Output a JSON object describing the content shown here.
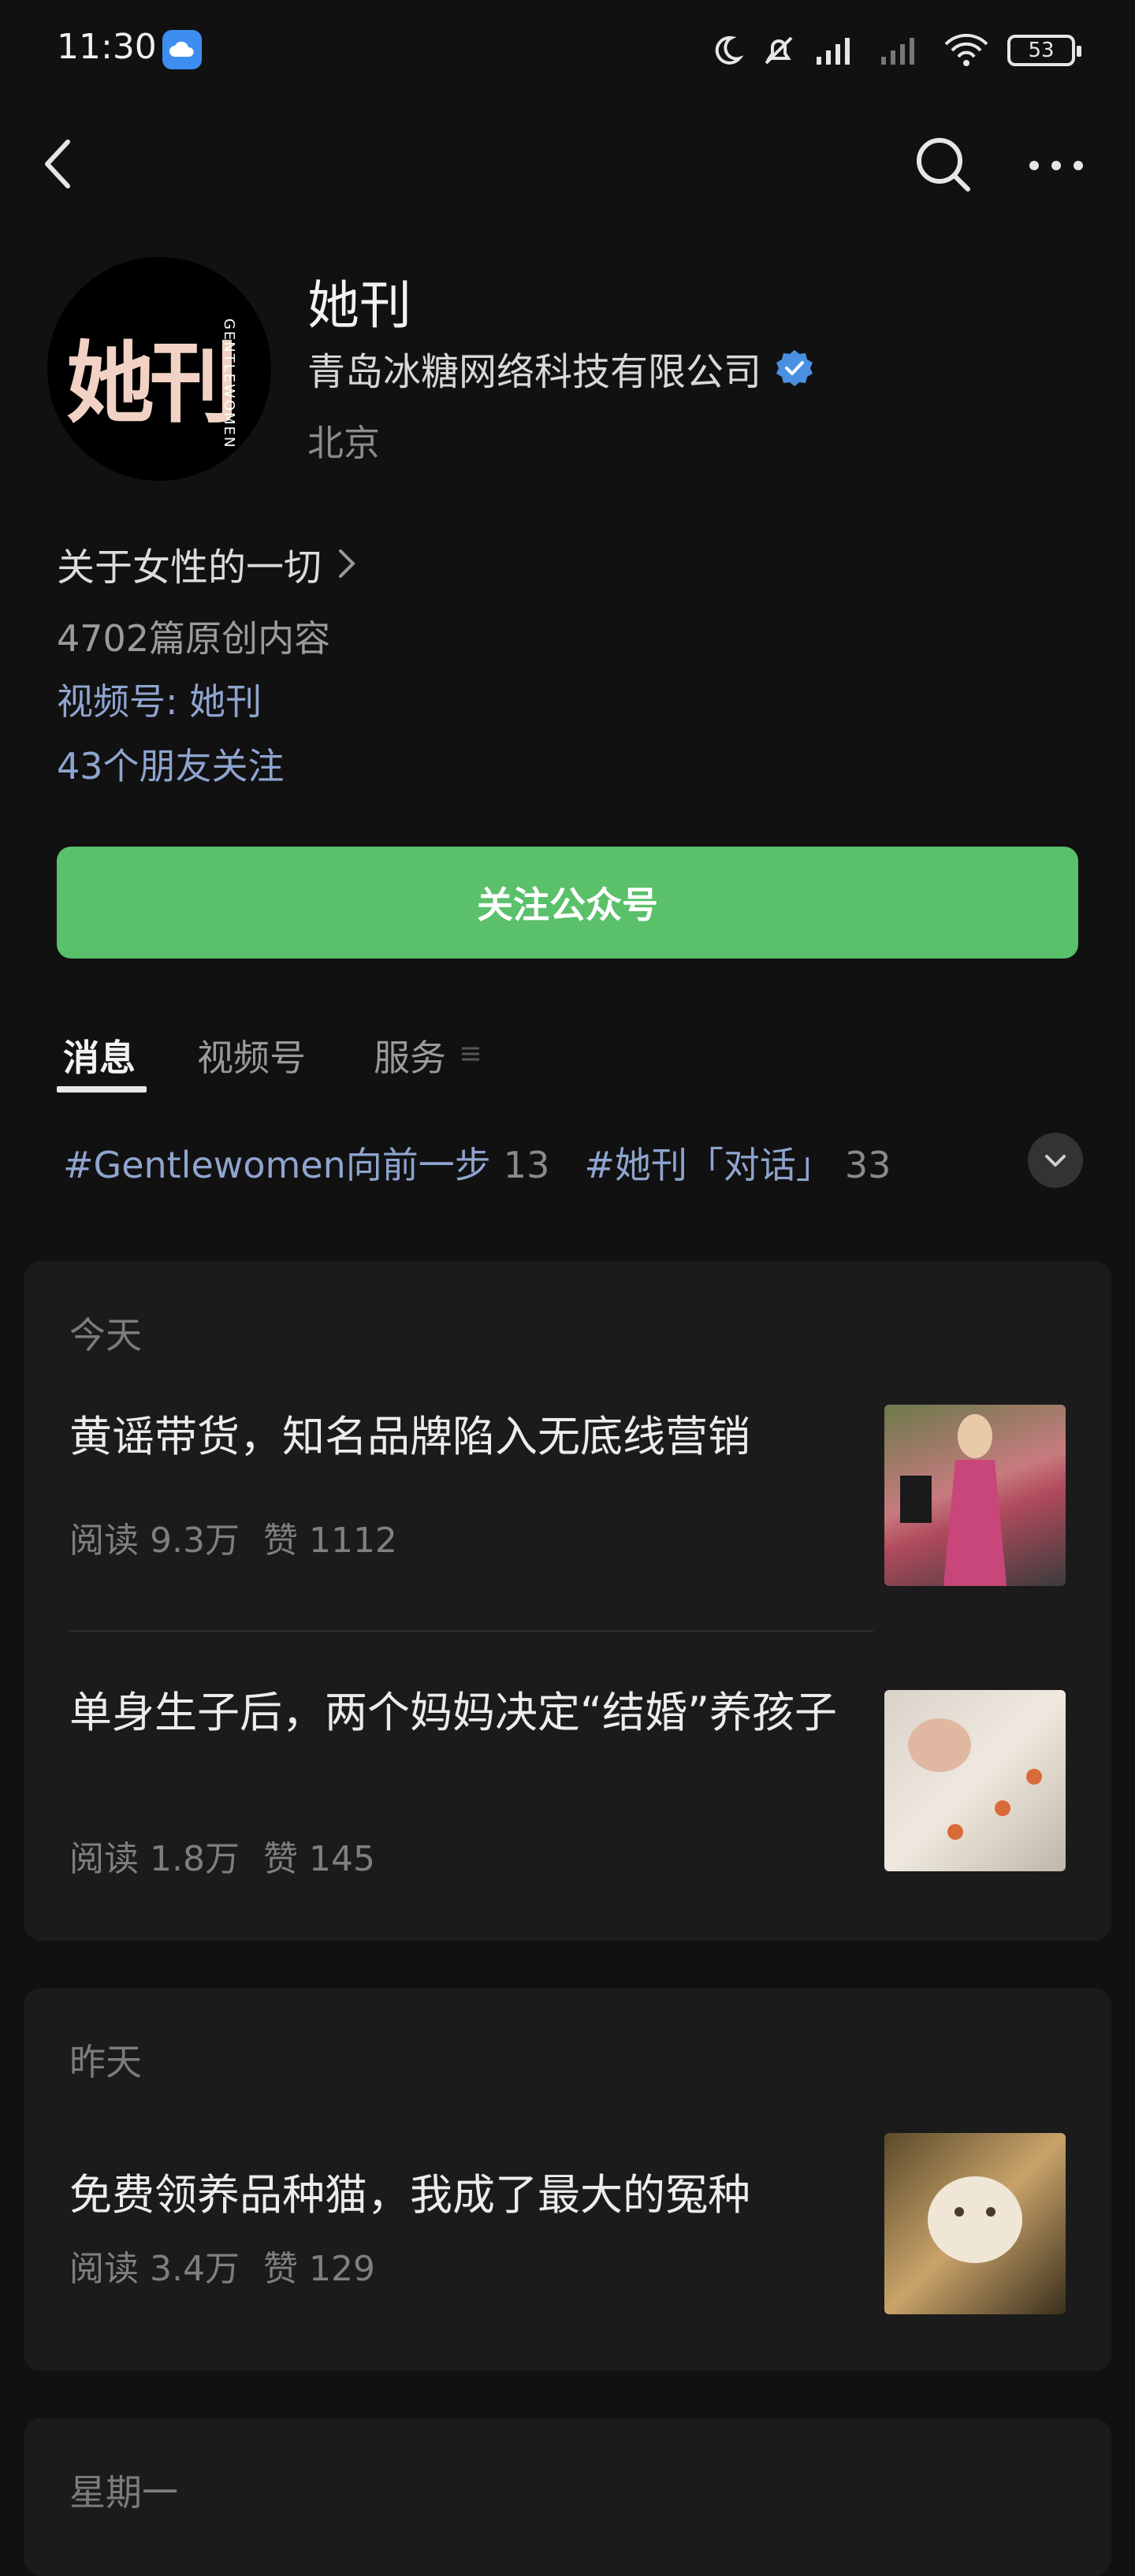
{
  "status_bar": {
    "time": "11:30",
    "battery": "53"
  },
  "profile": {
    "avatar_text": "她刊",
    "avatar_subtext": "GENTLEWOMEN",
    "name": "她刊",
    "company": "青岛冰糖网络科技有限公司",
    "city": "北京",
    "description": "关于女性的一切",
    "original_count": "4702篇原创内容",
    "channel": "视频号: 她刊",
    "friends_following": "43个朋友关注"
  },
  "follow_button": {
    "label": "关注公众号",
    "color": "#5ac06a"
  },
  "tabs": [
    {
      "label": "消息",
      "active": true
    },
    {
      "label": "视频号",
      "active": false
    },
    {
      "label": "服务",
      "active": false
    }
  ],
  "tags": [
    {
      "label": "#Gentlewomen向前一步",
      "count": "13"
    },
    {
      "label": "#她刊「对话」",
      "count": "33"
    }
  ],
  "sections": [
    {
      "date": "今天",
      "articles": [
        {
          "title": "黄谣带货，知名品牌陷入无底线营销",
          "reads": "阅读 9.3万",
          "likes": "赞 1112"
        },
        {
          "title": "单身生子后，两个妈妈决定“结婚”养孩子",
          "reads": "阅读 1.8万",
          "likes": "赞 145"
        }
      ]
    },
    {
      "date": "昨天",
      "articles": [
        {
          "title": "免费领养品种猫，我成了最大的冤种",
          "reads": "阅读 3.4万",
          "likes": "赞 129"
        }
      ]
    },
    {
      "date": "星期一",
      "articles": []
    }
  ]
}
